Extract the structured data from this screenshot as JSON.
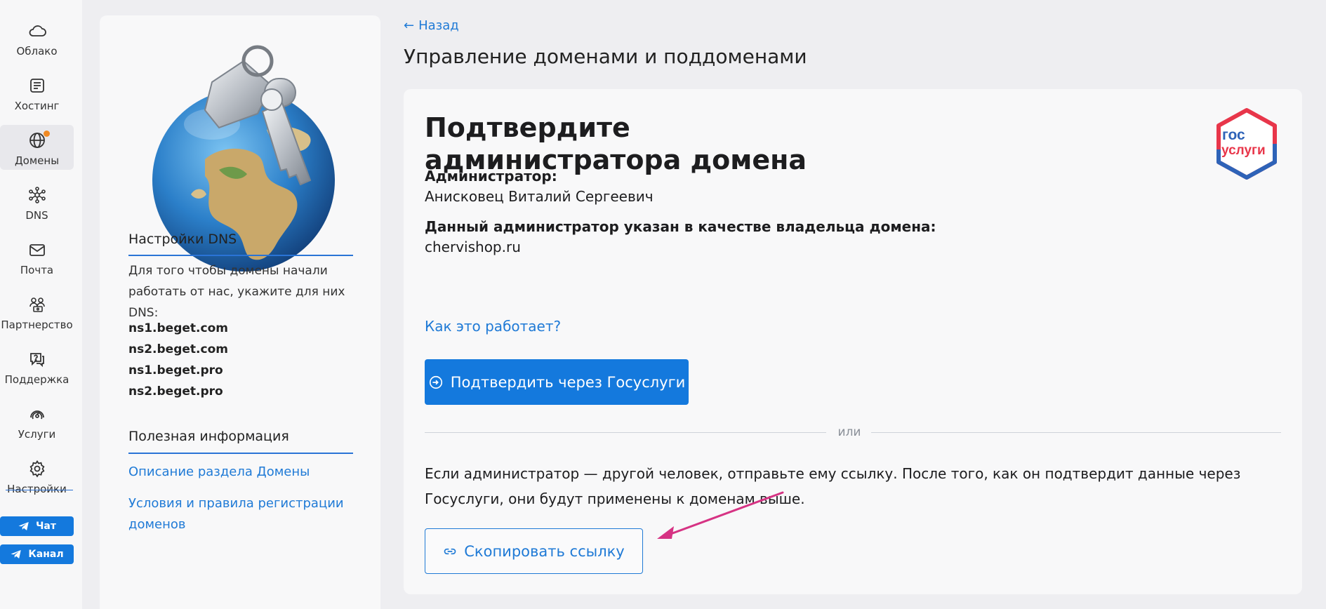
{
  "nav": {
    "items": [
      {
        "label": "Облако",
        "icon": "cloud-icon"
      },
      {
        "label": "Хостинг",
        "icon": "hosting-icon"
      },
      {
        "label": "Домены",
        "icon": "globe-icon"
      },
      {
        "label": "DNS",
        "icon": "dns-icon"
      },
      {
        "label": "Почта",
        "icon": "mail-icon"
      },
      {
        "label": "Партнерство",
        "icon": "partnership-icon"
      },
      {
        "label": "Поддержка",
        "icon": "support-icon"
      },
      {
        "label": "Услуги",
        "icon": "services-icon"
      },
      {
        "label": "Настройки",
        "icon": "gear-icon"
      }
    ],
    "chat_label": "Чат",
    "channel_label": "Канал"
  },
  "info": {
    "dns_heading": "Настройки DNS",
    "dns_text": "Для того чтобы домены начали работать от нас, укажите для них DNS:",
    "nameservers": [
      "ns1.beget.com",
      "ns2.beget.com",
      "ns1.beget.pro",
      "ns2.beget.pro"
    ],
    "useful_heading": "Полезная информация",
    "links": [
      "Описание раздела Домены",
      "Условия и правила регистрации доменов"
    ]
  },
  "header": {
    "back_label": "Назад",
    "title": "Управление доменами и поддоменами"
  },
  "card": {
    "title_line1": "Подтвердите",
    "title_line2": "администратора домена",
    "logo_line1": "гос",
    "logo_line2": "услуги",
    "admin_label": "Администратор:",
    "admin_name": "Анисковец Виталий Сергеевич",
    "owner_label": "Данный администратор указан в качестве владельца домена:",
    "domain": "chervishop.ru",
    "how_link": "Как это работает?",
    "confirm_button": "Подтвердить через Госуслуги",
    "or_text": "или",
    "paragraph": "Если администратор — другой человек, отправьте ему ссылку. После того, как он подтвердит данные через Госуслуги, они будут применены к доменам выше.",
    "copy_button": "Скопировать ссылку"
  },
  "colors": {
    "accent": "#1479dd",
    "link": "#1f7ad6",
    "annotation_arrow": "#d63384",
    "badge": "#f08a24"
  }
}
